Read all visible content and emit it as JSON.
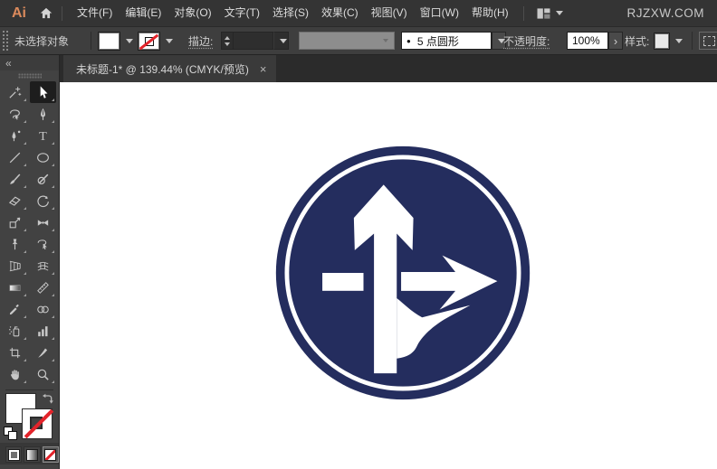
{
  "menubar": {
    "logo": "Ai",
    "items": [
      "文件(F)",
      "编辑(E)",
      "对象(O)",
      "文字(T)",
      "选择(S)",
      "效果(C)",
      "视图(V)",
      "窗口(W)",
      "帮助(H)"
    ],
    "watermark": "RJZXW.COM"
  },
  "controlbar": {
    "no_selection_label": "未选择对象",
    "stroke_label": "描边:",
    "stroke_weight_value": "",
    "brush_preview": "●",
    "brush_name": "5 点圆形",
    "opacity_label": "不透明度:",
    "opacity_value": "100%",
    "opacity_more": "›",
    "style_label": "样式:"
  },
  "tabbar": {
    "doc_title": "未标题-1* @ 139.44% (CMYK/预览)",
    "close": "×"
  },
  "toolbar": {
    "collapse": "«",
    "selected_tool": "selection-tool"
  },
  "canvas": {
    "sign_name": "straight-or-right-turn-traffic-sign"
  },
  "colors": {
    "sign_blue": "#242D5E",
    "sign_white": "#FFFFFF",
    "none_red": "#E3242B",
    "logo_amber": "#DB8A5C"
  }
}
